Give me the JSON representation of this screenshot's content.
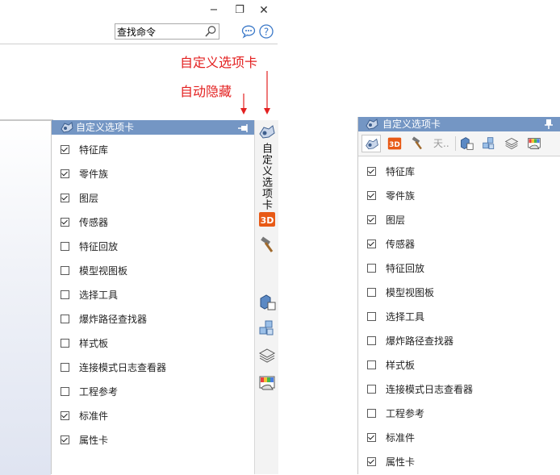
{
  "window": {
    "minimize_glyph": "−",
    "restore_glyph": "❐",
    "close_glyph": "✕"
  },
  "search": {
    "value": "查找命令",
    "icon": "search-icon"
  },
  "toolbar_icons": [
    "chat-bubble-icon",
    "help-icon"
  ],
  "annotations": {
    "custom_tab": "自定义选项卡",
    "auto_hide": "自动隐藏",
    "arrow_color": "#e32020"
  },
  "panel": {
    "title": "自定义选项卡",
    "vertical_tab_label": "自定义选项卡",
    "header_color": "#7496c4",
    "items": [
      {
        "label": "特征库",
        "checked": true
      },
      {
        "label": "零件族",
        "checked": true
      },
      {
        "label": "图层",
        "checked": true
      },
      {
        "label": "传感器",
        "checked": true
      },
      {
        "label": "特征回放",
        "checked": false
      },
      {
        "label": "模型视图板",
        "checked": false
      },
      {
        "label": "选择工具",
        "checked": false
      },
      {
        "label": "爆炸路径查找器",
        "checked": false
      },
      {
        "label": "样式板",
        "checked": false
      },
      {
        "label": "连接模式日志查看器",
        "checked": false
      },
      {
        "label": "工程参考",
        "checked": false
      },
      {
        "label": "标准件",
        "checked": true
      },
      {
        "label": "属性卡",
        "checked": true
      }
    ]
  },
  "side_tabs": [
    "custom-tab-icon",
    "3d-icon",
    "hammer-icon",
    "model-view-icon",
    "explode-path-icon",
    "layers-icon",
    "style-board-icon"
  ],
  "top_tabs": {
    "sky_label": "天.."
  }
}
